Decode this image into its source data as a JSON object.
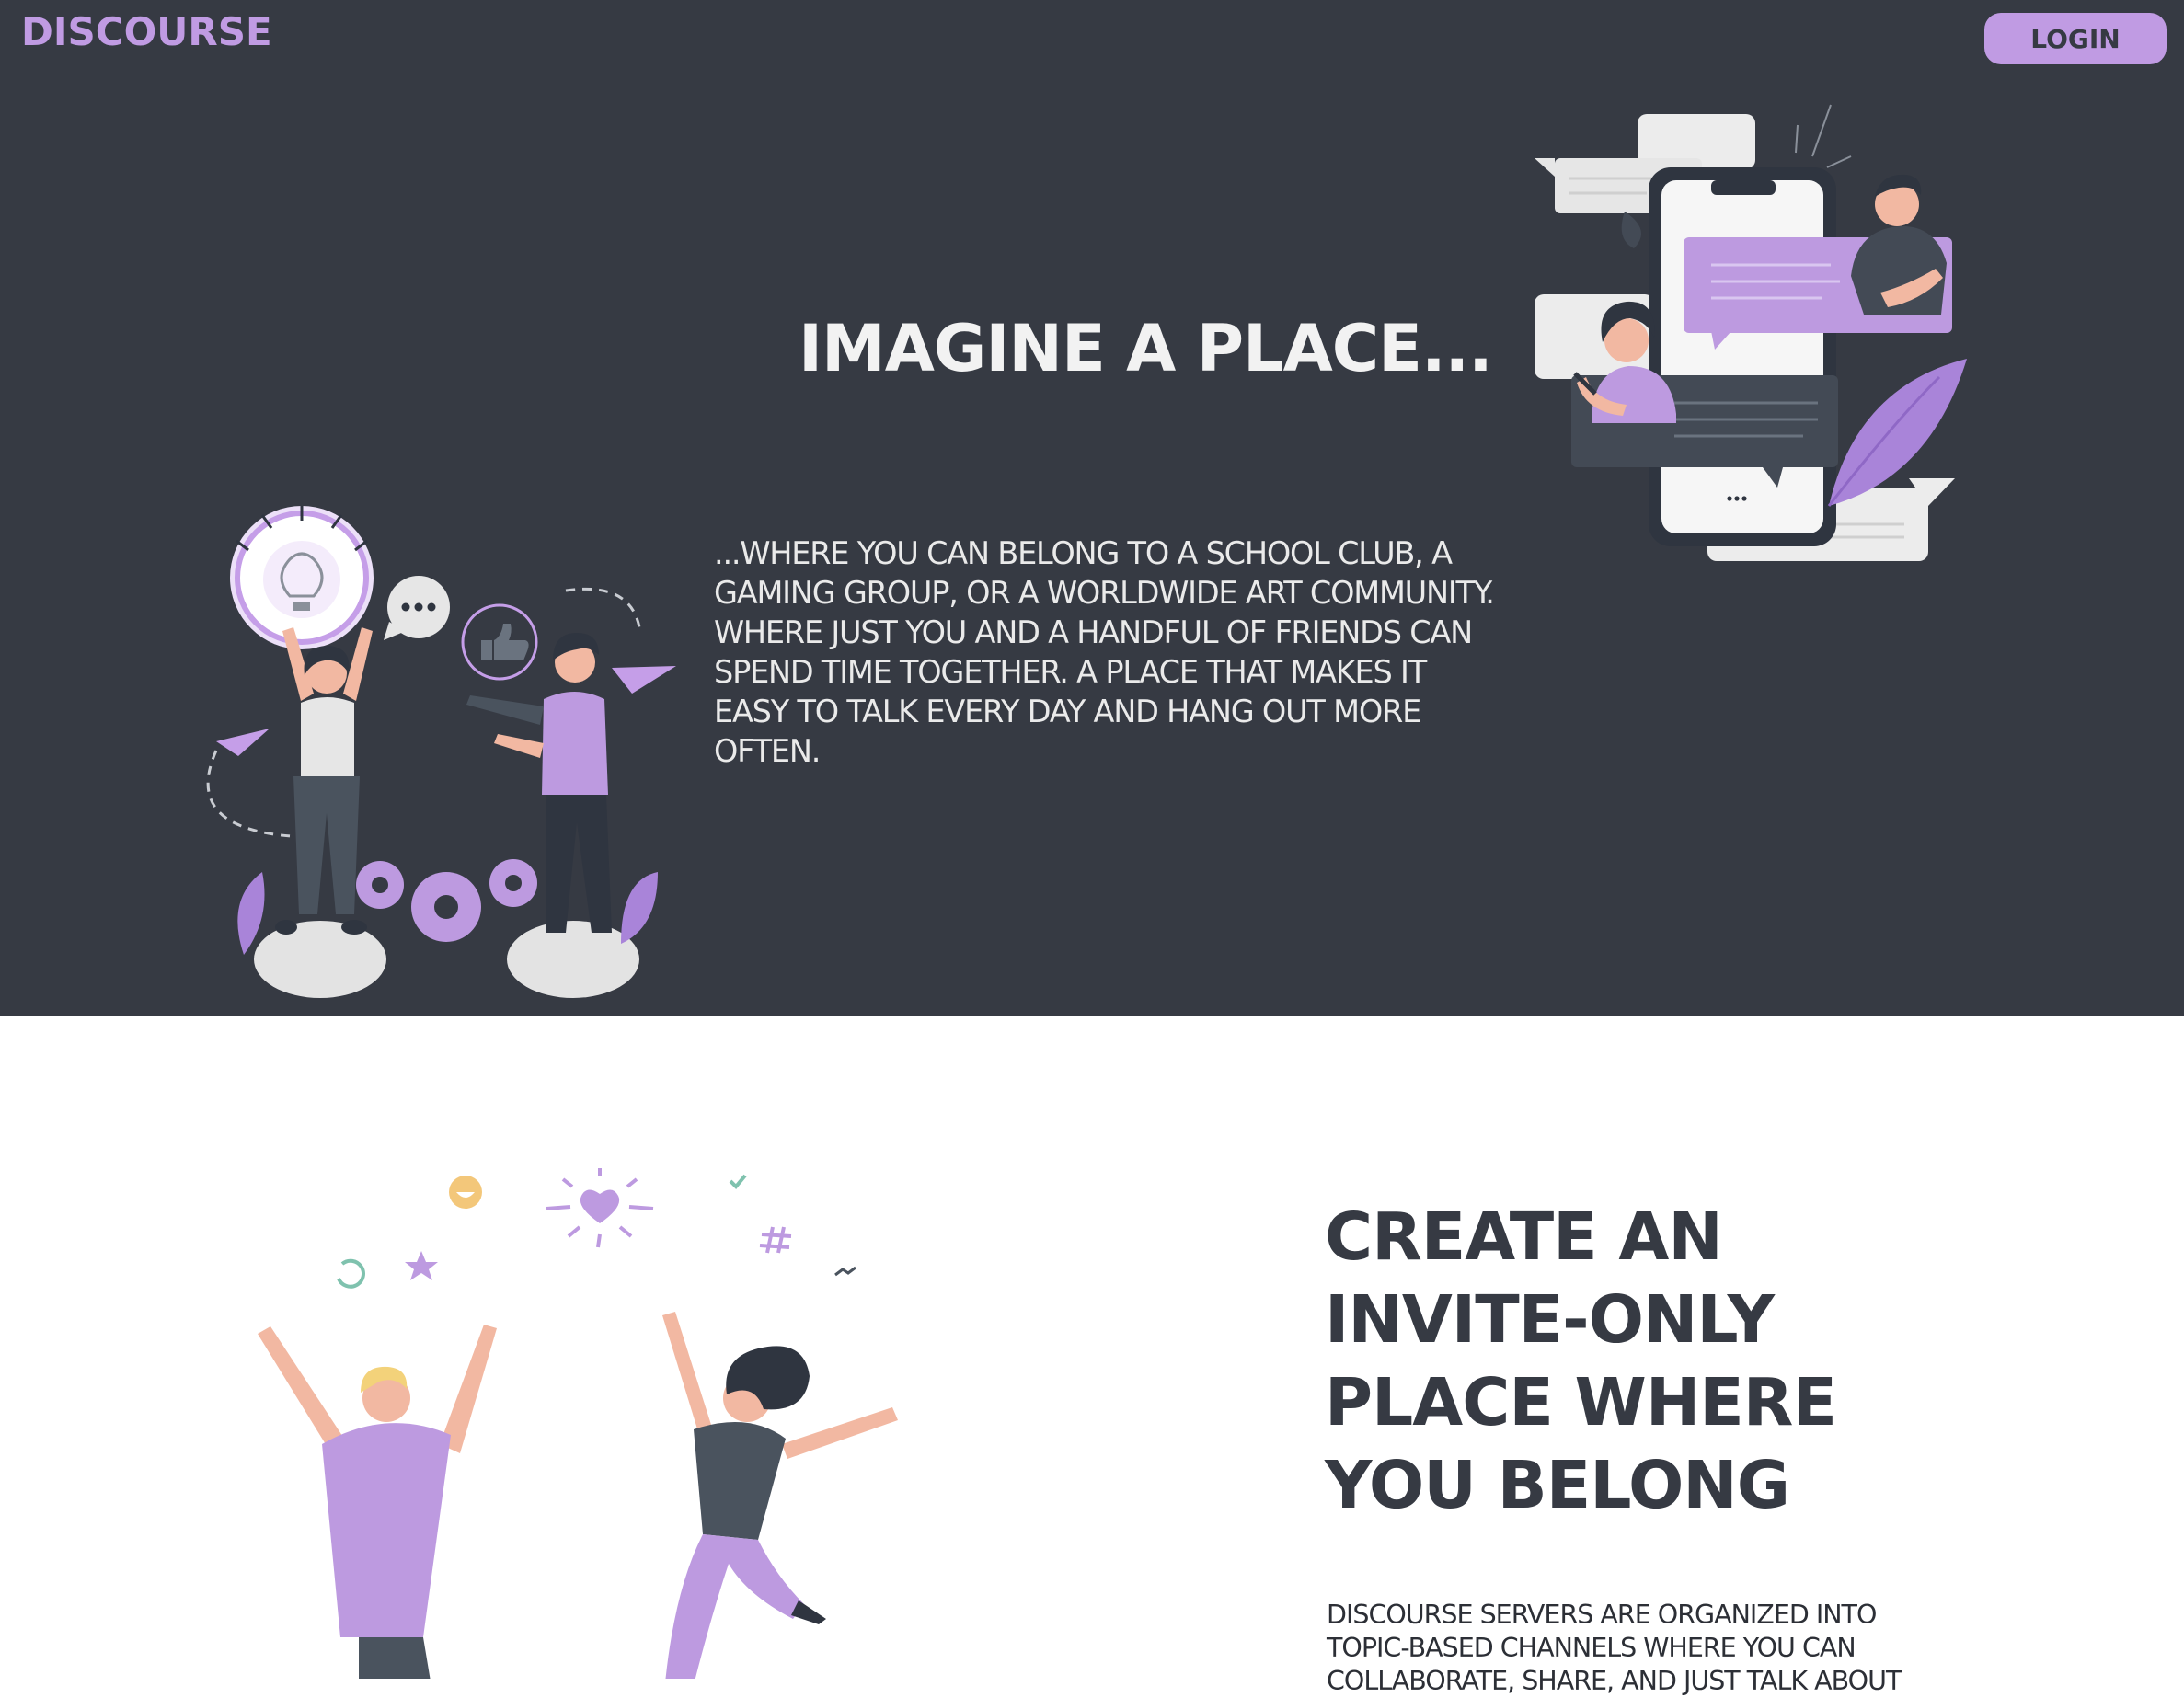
{
  "header": {
    "brand": "DISCOURSE",
    "login_label": "LOGIN"
  },
  "hero": {
    "title": "IMAGINE A PLACE...",
    "text": "...WHERE YOU CAN BELONG TO A SCHOOL CLUB, A GAMING GROUP, OR A WORLDWIDE ART COMMUNITY. WHERE JUST YOU AND A HANDFUL OF FRIENDS CAN SPEND TIME TOGETHER. A PLACE THAT MAKES IT EASY TO TALK EVERY DAY AND HANG OUT MORE OFTEN."
  },
  "section2": {
    "title": "CREATE AN INVITE-ONLY PLACE WHERE YOU BELONG",
    "text": "DISCOURSE SERVERS ARE ORGANIZED INTO TOPIC-BASED CHANNELS WHERE YOU CAN COLLABORATE, SHARE, AND JUST TALK ABOUT"
  },
  "colors": {
    "hero_bg": "#363a43",
    "accent": "#c09be3",
    "page_bg": "#ffffff"
  },
  "icons": [
    "lightbulb-icon",
    "chat-bubble-icon",
    "thumbs-up-icon",
    "paper-plane-icon",
    "gear-icon",
    "heart-icon",
    "smiley-icon",
    "star-icon",
    "hashtag-icon",
    "check-icon",
    "phone-icon"
  ]
}
